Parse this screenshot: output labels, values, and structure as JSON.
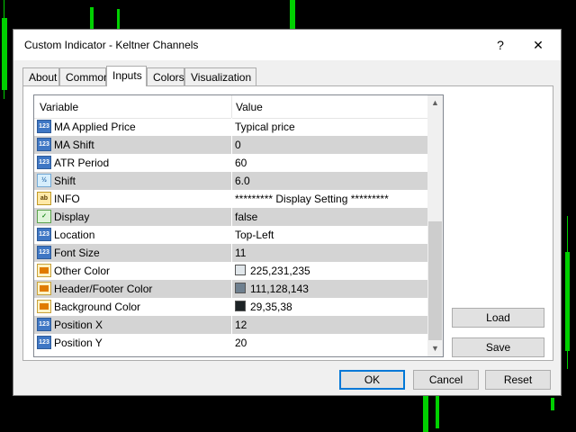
{
  "window": {
    "title": "Custom Indicator - Keltner Channels",
    "help_label": "?",
    "close_label": "✕"
  },
  "tabs": [
    "About",
    "Common",
    "Inputs",
    "Colors",
    "Visualization"
  ],
  "active_tab": "Inputs",
  "grid": {
    "columns": [
      "Variable",
      "Value"
    ],
    "rows": [
      {
        "icon": "numeric-icon",
        "type": "num",
        "variable": "MA Applied Price",
        "value": "Typical price"
      },
      {
        "icon": "numeric-icon",
        "type": "num",
        "variable": "MA Shift",
        "value": "0"
      },
      {
        "icon": "numeric-icon",
        "type": "num",
        "variable": "ATR Period",
        "value": "60"
      },
      {
        "icon": "double-icon",
        "type": "dbl",
        "variable": "Shift",
        "value": "6.0"
      },
      {
        "icon": "string-icon",
        "type": "str",
        "variable": "INFO",
        "value": "********* Display Setting *********"
      },
      {
        "icon": "bool-icon",
        "type": "bool",
        "variable": "Display",
        "value": "false"
      },
      {
        "icon": "numeric-icon",
        "type": "num",
        "variable": "Location",
        "value": "Top-Left"
      },
      {
        "icon": "numeric-icon",
        "type": "num",
        "variable": "Font Size",
        "value": "11"
      },
      {
        "icon": "color-icon",
        "type": "col",
        "variable": "Other Color",
        "value": "225,231,235",
        "swatch": "#e1e7eb"
      },
      {
        "icon": "color-icon",
        "type": "col",
        "variable": "Header/Footer Color",
        "value": "111,128,143",
        "swatch": "#6f808f"
      },
      {
        "icon": "color-icon",
        "type": "col",
        "variable": "Background Color",
        "value": "29,35,38",
        "swatch": "#1d2326"
      },
      {
        "icon": "numeric-icon",
        "type": "num",
        "variable": "Position X",
        "value": "12"
      },
      {
        "icon": "numeric-icon",
        "type": "num",
        "variable": "Position Y",
        "value": "20"
      }
    ]
  },
  "icon_glyphs": {
    "num": "123",
    "dbl": "½",
    "str": "ab",
    "bool": "✓",
    "col": ""
  },
  "buttons": {
    "load": "Load",
    "save": "Save",
    "ok": "OK",
    "cancel": "Cancel",
    "reset": "Reset"
  },
  "colors": {
    "chart_background": "#000000",
    "candles": "#00d000",
    "alt_row": "#d4d4d4",
    "default_button_border": "#0078d7"
  }
}
